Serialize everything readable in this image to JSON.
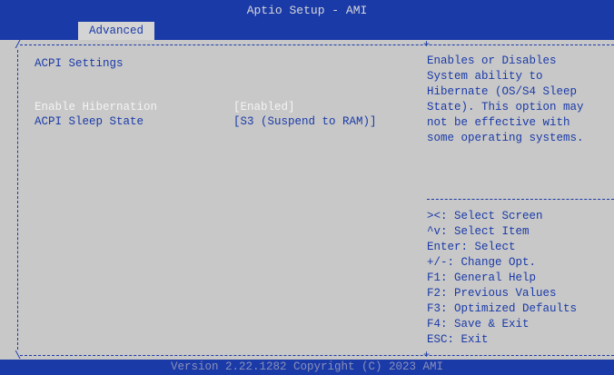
{
  "header": {
    "title": "Aptio Setup - AMI",
    "active_tab": "Advanced"
  },
  "main": {
    "section_title": "ACPI Settings",
    "items": [
      {
        "label": "Enable Hibernation",
        "value": "[Enabled]",
        "selected": true
      },
      {
        "label": "ACPI Sleep State",
        "value": "[S3 (Suspend to RAM)]",
        "selected": false
      }
    ]
  },
  "help": {
    "description": [
      "Enables or Disables",
      "System ability to",
      "Hibernate (OS/S4 Sleep",
      "State). This option may",
      "not be effective with",
      "some operating systems."
    ],
    "keys": [
      "><: Select Screen",
      "^v: Select Item",
      "Enter: Select",
      "+/-: Change Opt.",
      "F1: General Help",
      "F2: Previous Values",
      "F3: Optimized Defaults",
      "F4: Save & Exit",
      "ESC: Exit"
    ]
  },
  "footer": {
    "version": "Version 2.22.1282 Copyright (C) 2023 AMI"
  },
  "colors": {
    "header_bg": "#1a3aa8",
    "panel_bg": "#c8c8c8",
    "text_blue": "#1a3aa8",
    "selected_text": "#f4f4f4"
  }
}
